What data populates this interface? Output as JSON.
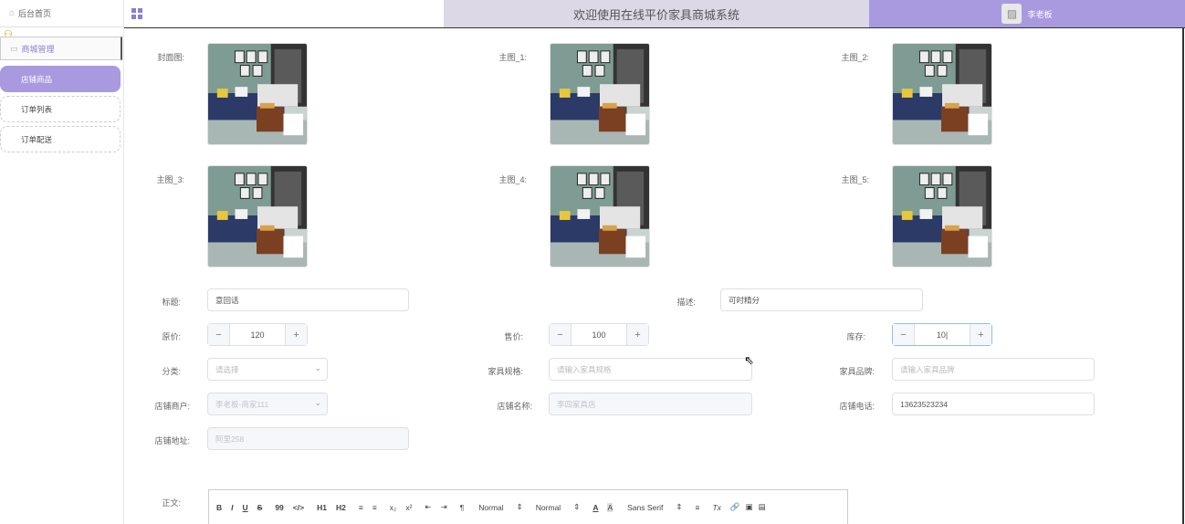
{
  "sidebar": {
    "home": "后台首页",
    "group": "商城管理",
    "items": [
      "店铺商品",
      "订单列表",
      "订单配送"
    ]
  },
  "header": {
    "title": "欢迎使用在线平价家具商城系统",
    "user": "李老板"
  },
  "images": {
    "labels": [
      "封面图:",
      "主图_1:",
      "主图_2:",
      "主图_3:",
      "主图_4:",
      "主图_5:"
    ]
  },
  "form": {
    "title_label": "标题:",
    "title_value": "意回话",
    "desc_label": "描述:",
    "desc_value": "可时精分",
    "orig_price_label": "原价:",
    "orig_price_value": "120",
    "price_label": "售价:",
    "price_value": "100",
    "stock_label": "库存:",
    "stock_value": "10|",
    "category_label": "分类:",
    "category_placeholder": "请选择",
    "spec_label": "家具规格:",
    "spec_placeholder": "请输入家具规格",
    "brand_label": "家具品牌:",
    "brand_placeholder": "请输入家具品牌",
    "merchant_label": "店铺商户:",
    "merchant_value": "李老板-商家111",
    "shop_name_label": "店铺名称:",
    "shop_name_value": "李四家具店",
    "phone_label": "店铺电话:",
    "phone_value": "13623523234",
    "address_label": "店铺地址:",
    "address_value": "阿里258",
    "content_label": "正文:"
  },
  "editor_toolbar": [
    "B",
    "I",
    "U",
    "S",
    "99",
    "</>",
    "H1",
    "H2",
    "≡",
    "≡",
    "x₂",
    "x²",
    "⇤",
    "⇥",
    "¶",
    "Normal",
    "⇕",
    "Normal",
    "⇕",
    "A",
    "A",
    "Sans Serif",
    "⇕",
    "≡",
    "Tx",
    "🔗",
    "▣",
    "▤"
  ],
  "colors": {
    "accent": "#a99ae0",
    "header_title_bg": "#dcd8e6"
  }
}
